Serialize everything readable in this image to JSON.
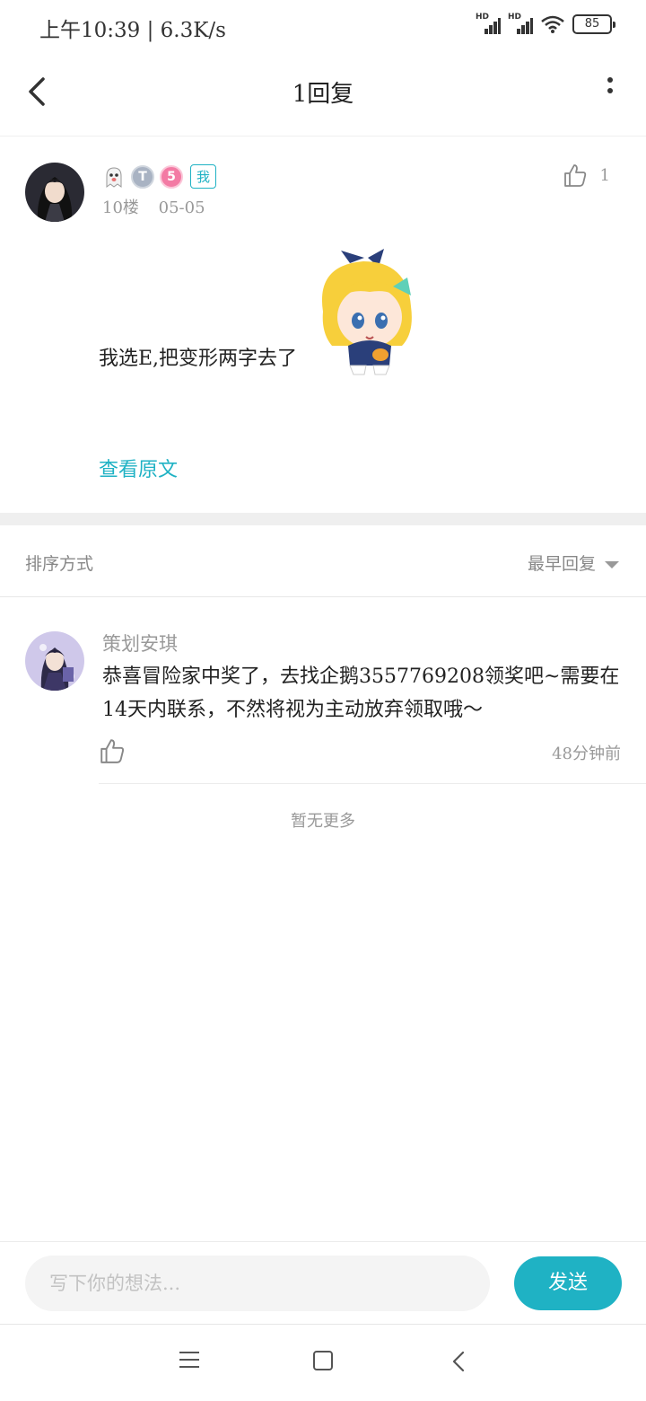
{
  "status_bar": {
    "time_speed": "上午10:39 | 6.3K/s",
    "hd_label": "HD",
    "battery": "85"
  },
  "header": {
    "title": "1回复"
  },
  "post": {
    "badge_me": "我",
    "badge_level": "5",
    "badge_t": "T",
    "floor": "10楼",
    "date": "05-05",
    "like_count": "1",
    "text": "我选E,把变形两字去了",
    "view_original": "查看原文"
  },
  "sort": {
    "label": "排序方式",
    "value": "最早回复"
  },
  "reply": {
    "author": "策划安琪",
    "text": "恭喜冒险家中奖了，去找企鹅3557769208领奖吧~需要在14天内联系，不然将视为主动放弃领取哦～",
    "time": "48分钟前"
  },
  "no_more": "暂无更多",
  "composer": {
    "placeholder": "写下你的想法...",
    "send_label": "发送"
  },
  "colors": {
    "accent": "#1fb2c4",
    "divider": "#efefef",
    "muted": "#999999"
  }
}
